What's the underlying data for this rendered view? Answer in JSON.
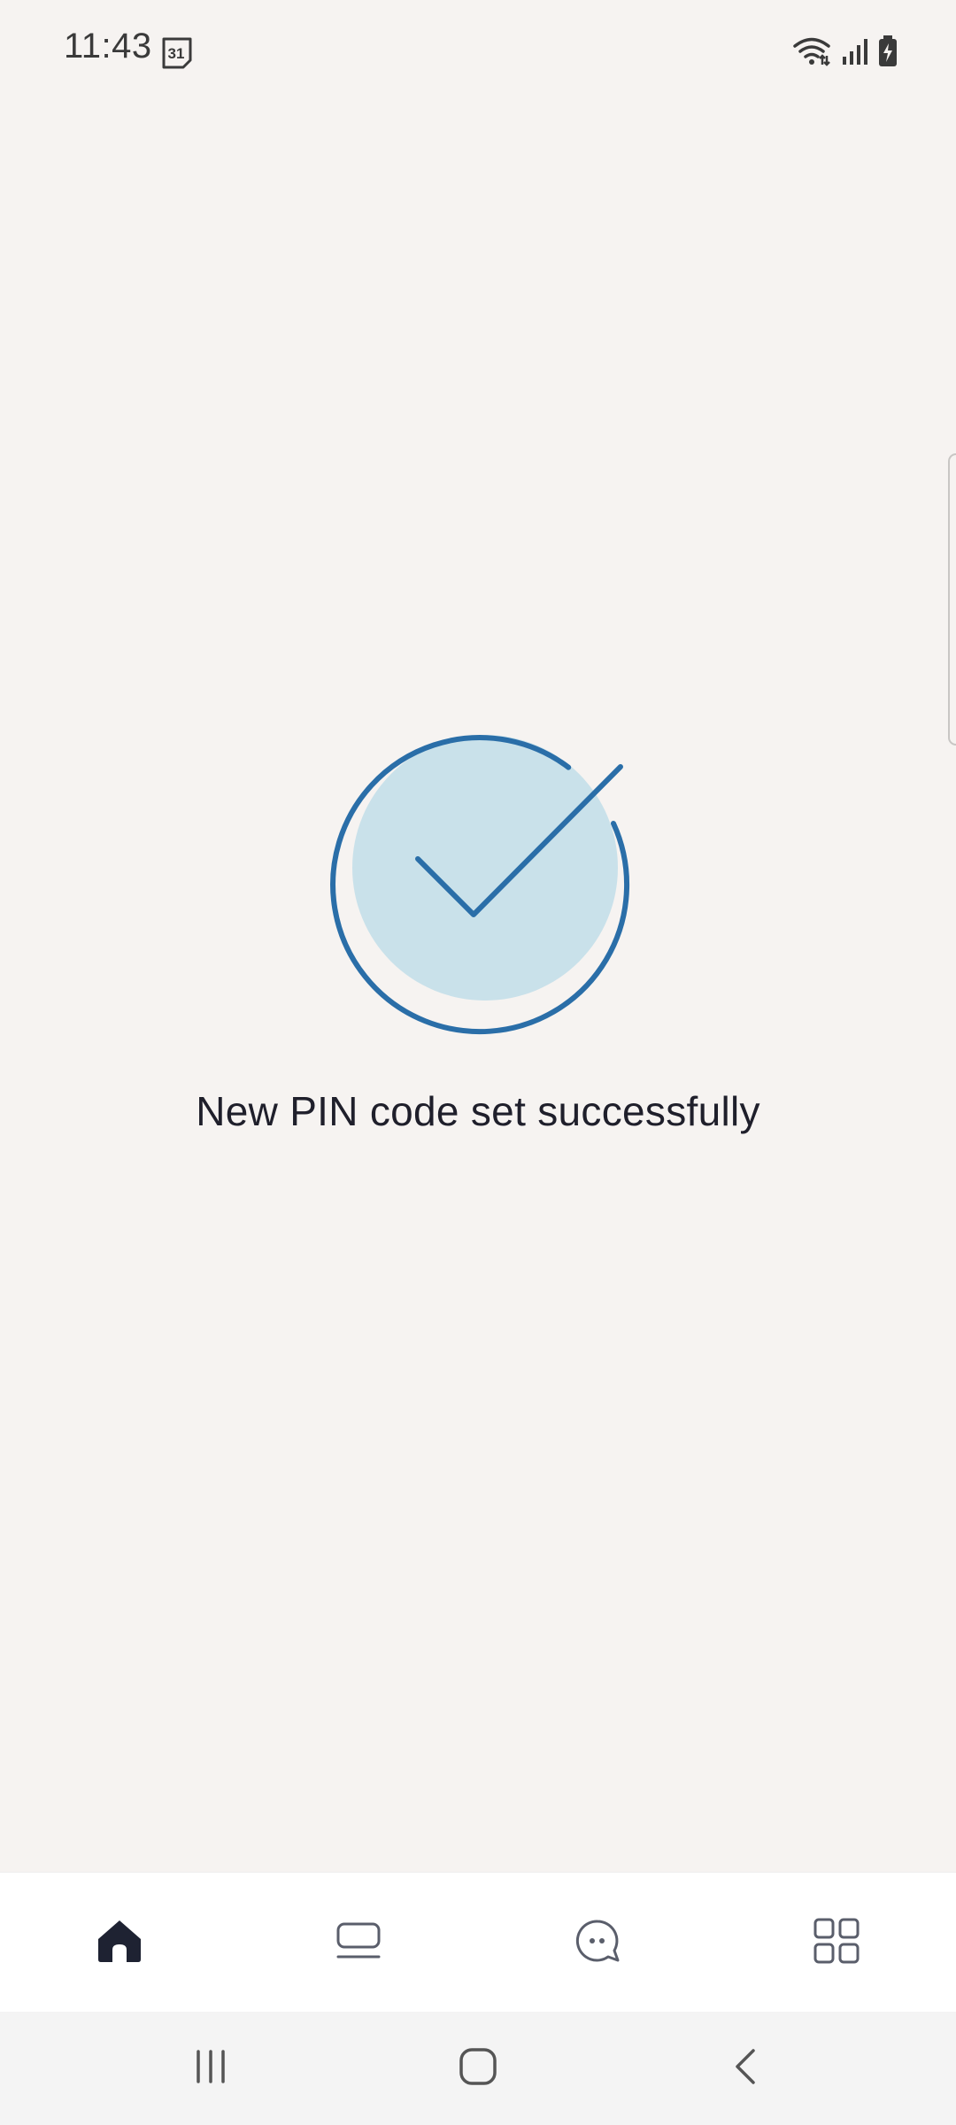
{
  "status_bar": {
    "time": "11:43",
    "calendar_day": "31",
    "icons": [
      "calendar-icon",
      "wifi-icon",
      "signal-icon",
      "battery-charging-icon"
    ]
  },
  "main": {
    "message": "New PIN code set successfully",
    "illustration_icon": "checkmark-circle-icon"
  },
  "colors": {
    "background": "#f6f3f1",
    "accent_blue": "#2a6ea8",
    "circle_fill": "#c9e1ea",
    "text_dark": "#1f1f2b",
    "tab_bar_bg": "#ffffff"
  },
  "tab_bar": {
    "tabs": [
      {
        "icon": "home-icon",
        "active": true
      },
      {
        "icon": "cards-icon",
        "active": false
      },
      {
        "icon": "chat-icon",
        "active": false
      },
      {
        "icon": "grid-menu-icon",
        "active": false
      }
    ]
  },
  "system_nav": {
    "buttons": [
      "recent-apps-icon",
      "home-button-icon",
      "back-icon"
    ]
  }
}
